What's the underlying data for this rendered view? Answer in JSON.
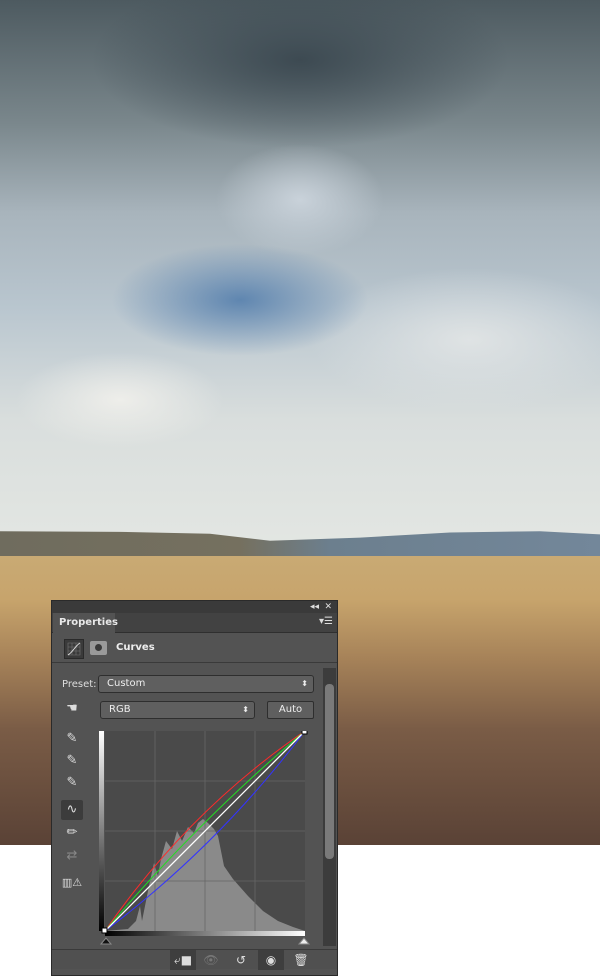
{
  "panel": {
    "tab_label": "Properties",
    "collapse_icon": "double-chevron-left-icon",
    "close_icon": "close-icon",
    "adjustment_title": "Curves",
    "preset_label": "Preset:",
    "preset_value": "Custom",
    "channel_value": "RGB",
    "auto_label": "Auto",
    "tools": [
      "target-adjust-icon",
      "black-point-eyedropper-icon",
      "gray-point-eyedropper-icon",
      "white-point-eyedropper-icon",
      "curve-points-icon",
      "pencil-icon",
      "smooth-icon",
      "clipping-warning-icon"
    ],
    "bottom_buttons": [
      "clip-to-layer-icon",
      "view-previous-icon",
      "reset-icon",
      "visibility-eye-icon",
      "trash-icon"
    ],
    "curve_colors": {
      "rgb": "#ffffff",
      "red": "#ff2a2a",
      "green": "#22dd22",
      "blue": "#3333ff"
    }
  }
}
